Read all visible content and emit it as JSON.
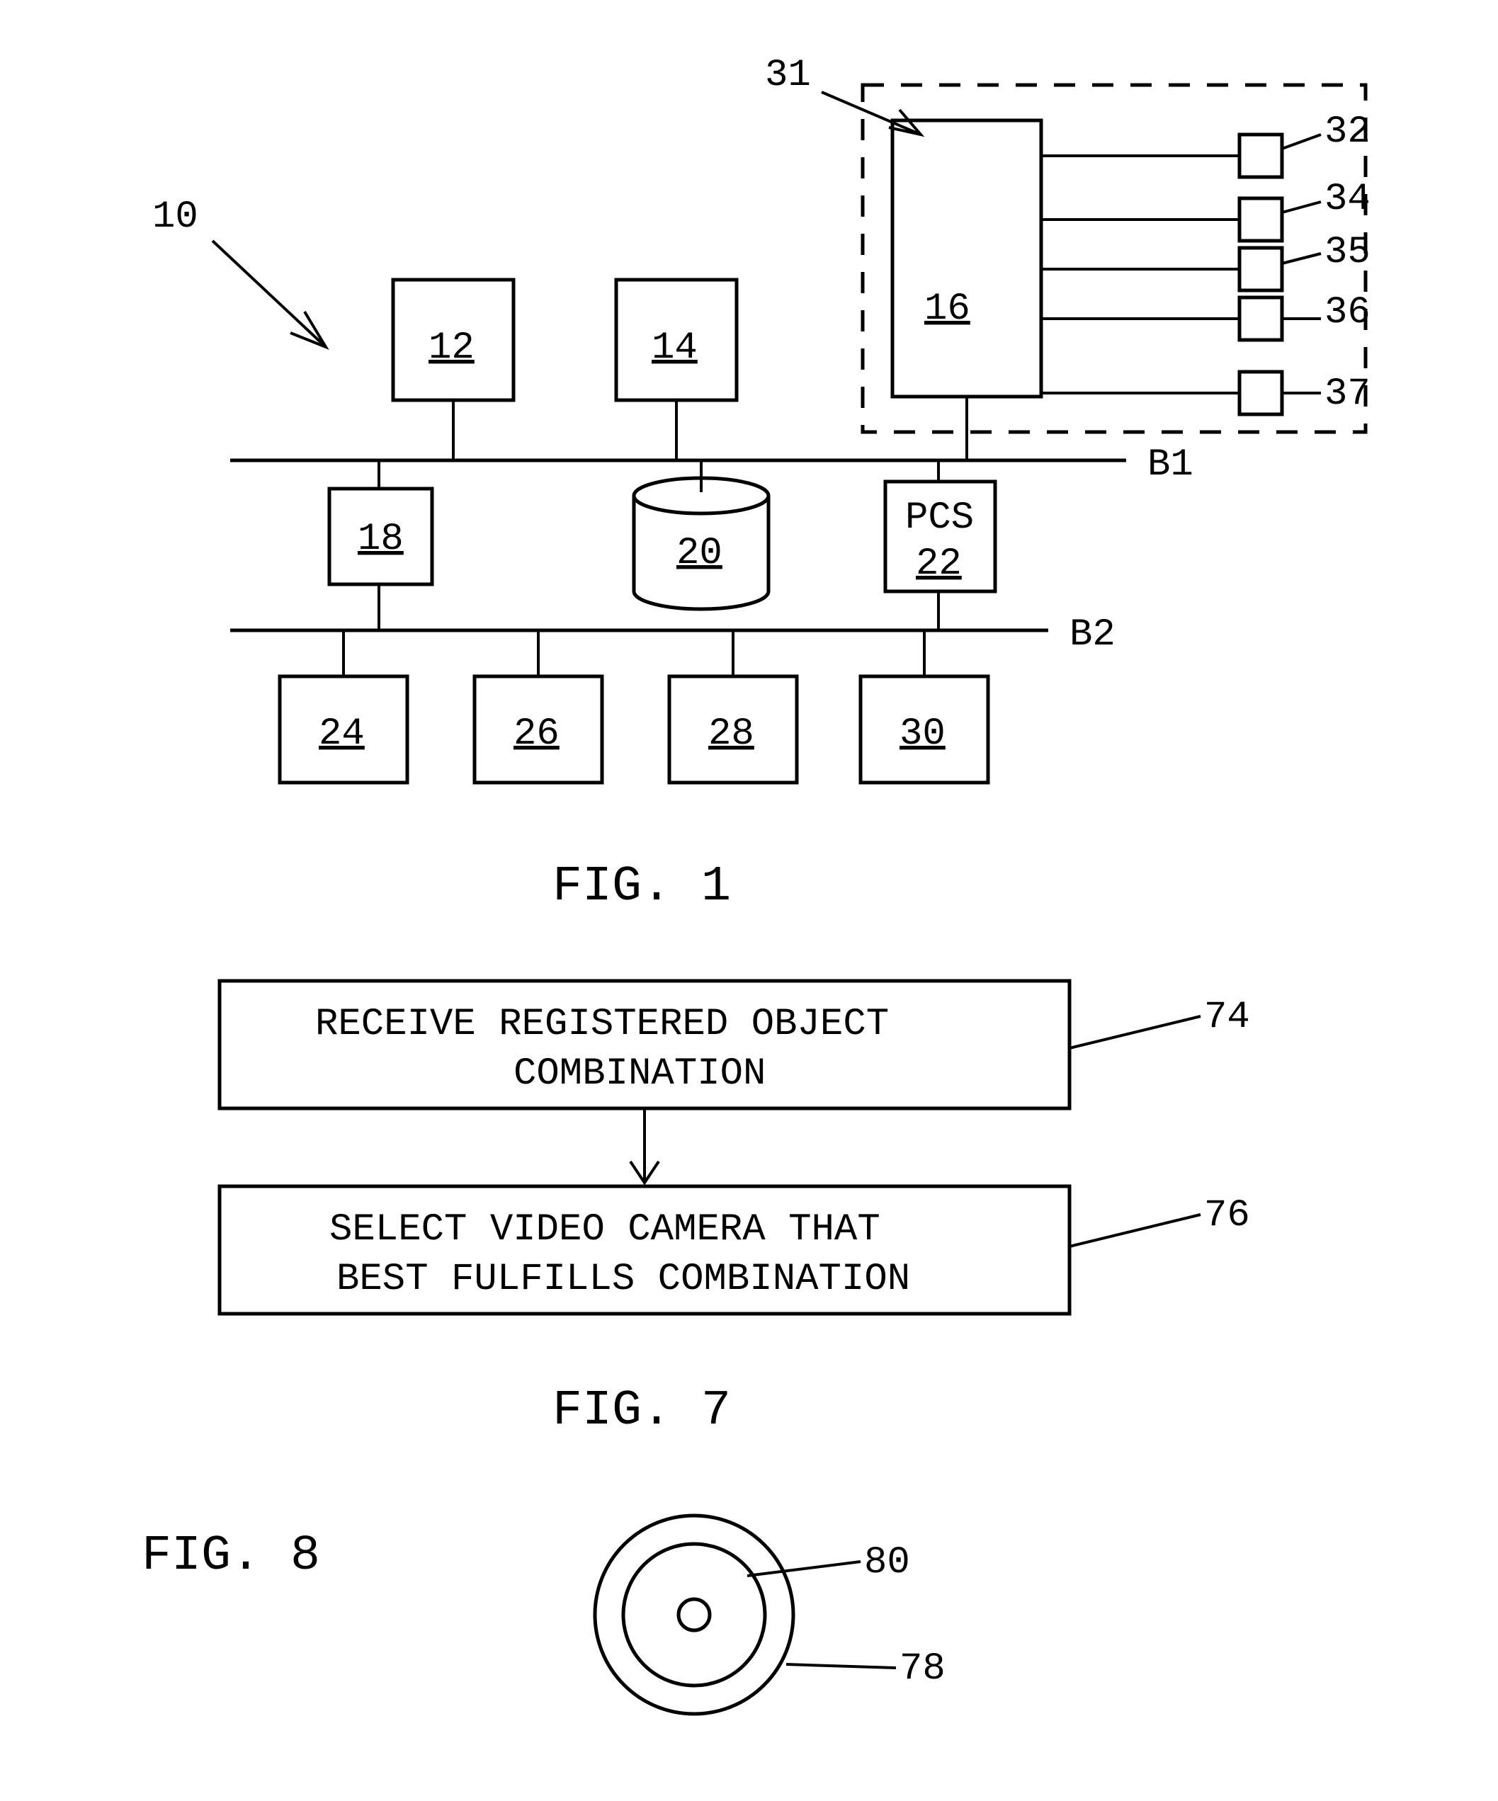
{
  "fig1": {
    "caption": "FIG. 1",
    "labels": {
      "n10": "10",
      "n12": "12",
      "n14": "14",
      "n16": "16",
      "n18": "18",
      "n20": "20",
      "pcs": "PCS",
      "n22": "22",
      "n24": "24",
      "n26": "26",
      "n28": "28",
      "n30": "30",
      "n31": "31",
      "n32": "32",
      "n34": "34",
      "n35": "35",
      "n36": "36",
      "n37": "37",
      "b1": "B1",
      "b2": "B2"
    }
  },
  "fig7": {
    "caption": "FIG. 7",
    "box74_line1": "RECEIVE REGISTERED OBJECT",
    "box74_line2": "COMBINATION",
    "box76_line1": "SELECT VIDEO CAMERA THAT",
    "box76_line2": "BEST FULFILLS COMBINATION",
    "n74": "74",
    "n76": "76"
  },
  "fig8": {
    "caption": "FIG. 8",
    "n80": "80",
    "n78": "78"
  },
  "chart_data": [
    {
      "type": "diagram",
      "title": "FIG. 1 – system block diagram",
      "nodes": [
        {
          "id": "10",
          "kind": "system-callout"
        },
        {
          "id": "12",
          "kind": "box"
        },
        {
          "id": "14",
          "kind": "box"
        },
        {
          "id": "16",
          "kind": "box",
          "inside_group": "31"
        },
        {
          "id": "18",
          "kind": "box"
        },
        {
          "id": "20",
          "kind": "cylinder"
        },
        {
          "id": "22",
          "kind": "box",
          "label": "PCS"
        },
        {
          "id": "24",
          "kind": "box"
        },
        {
          "id": "26",
          "kind": "box"
        },
        {
          "id": "28",
          "kind": "box"
        },
        {
          "id": "30",
          "kind": "box"
        },
        {
          "id": "31",
          "kind": "dashed-group",
          "contains": [
            "16",
            "32",
            "34",
            "35",
            "36",
            "37"
          ]
        },
        {
          "id": "32",
          "kind": "small-box"
        },
        {
          "id": "34",
          "kind": "small-box"
        },
        {
          "id": "35",
          "kind": "small-box"
        },
        {
          "id": "36",
          "kind": "small-box"
        },
        {
          "id": "37",
          "kind": "small-box"
        },
        {
          "id": "B1",
          "kind": "bus"
        },
        {
          "id": "B2",
          "kind": "bus"
        }
      ],
      "edges": [
        {
          "from": "12",
          "to": "B1"
        },
        {
          "from": "14",
          "to": "B1"
        },
        {
          "from": "16",
          "to": "B1"
        },
        {
          "from": "18",
          "to": "B1"
        },
        {
          "from": "20",
          "to": "B1"
        },
        {
          "from": "22",
          "to": "B1"
        },
        {
          "from": "18",
          "to": "B2"
        },
        {
          "from": "22",
          "to": "B2"
        },
        {
          "from": "24",
          "to": "B2"
        },
        {
          "from": "26",
          "to": "B2"
        },
        {
          "from": "28",
          "to": "B2"
        },
        {
          "from": "30",
          "to": "B2"
        },
        {
          "from": "16",
          "to": "32"
        },
        {
          "from": "16",
          "to": "34"
        },
        {
          "from": "16",
          "to": "35"
        },
        {
          "from": "16",
          "to": "36"
        },
        {
          "from": "16",
          "to": "37"
        }
      ]
    },
    {
      "type": "diagram",
      "title": "FIG. 7 – flowchart",
      "steps": [
        {
          "id": "74",
          "text": "RECEIVE REGISTERED OBJECT COMBINATION"
        },
        {
          "id": "76",
          "text": "SELECT VIDEO CAMERA THAT BEST FULFILLS COMBINATION"
        }
      ],
      "flow": [
        {
          "from": "74",
          "to": "76"
        }
      ]
    },
    {
      "type": "diagram",
      "title": "FIG. 8 – concentric circles",
      "parts": [
        {
          "id": "78",
          "kind": "outer-ring"
        },
        {
          "id": "80",
          "kind": "inner-circle"
        }
      ]
    }
  ]
}
